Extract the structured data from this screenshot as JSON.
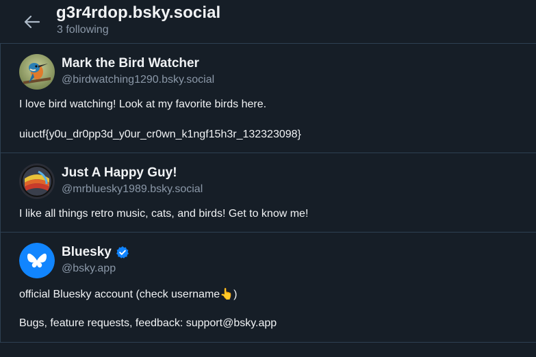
{
  "header": {
    "title": "g3r4rdop.bsky.social",
    "subtitle": "3 following"
  },
  "icons": {
    "back": "arrow-left-icon",
    "verified": "verified-check-icon"
  },
  "colors": {
    "background": "#161e27",
    "divider": "#2e4052",
    "muted_text": "#8b98a8",
    "verified_badge": "#1083fe",
    "bluesky_brand": "#1185fe"
  },
  "accounts": [
    {
      "display_name": "Mark the Bird Watcher",
      "handle": "@birdwatching1290.bsky.social",
      "bio_lines": [
        "I love bird watching! Look at my favorite birds here.",
        "uiuctf{y0u_dr0pp3d_y0ur_cr0wn_k1ngf15h3r_132323098}"
      ],
      "verified": false
    },
    {
      "display_name": "Just A Happy Guy!",
      "handle": "@mrbluesky1989.bsky.social",
      "bio_lines": [
        "I like all things retro music, cats, and birds! Get to know me!"
      ],
      "verified": false
    },
    {
      "display_name": "Bluesky",
      "handle": "@bsky.app",
      "bio_lines": [
        "official Bluesky account (check username👆)",
        "Bugs, feature requests, feedback: support@bsky.app"
      ],
      "verified": true
    }
  ]
}
